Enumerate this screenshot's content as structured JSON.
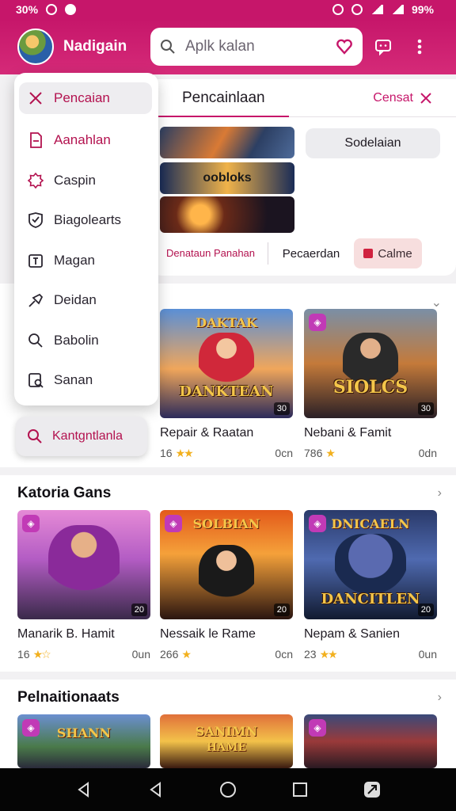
{
  "status_bar": {
    "left_text": "30%",
    "right_text": "99%"
  },
  "header": {
    "app_name": "Nadigain",
    "search_placeholder": "Aplk kalan"
  },
  "tab_strip": {
    "active_tab": "Pencainlaan",
    "cancel_label": "Censat"
  },
  "panel": {
    "banner_label": "oobloks",
    "side_button": "Sodelaian",
    "chip_1": "Denataun Panahan",
    "chip_2": "Pecaerdan",
    "chip_3": "Calme"
  },
  "menu": {
    "items": [
      {
        "label": "Pencaian",
        "icon": "close-icon"
      },
      {
        "label": "Aanahlan",
        "icon": "document-icon"
      },
      {
        "label": "Caspin",
        "icon": "badge-icon"
      },
      {
        "label": "Biagolearts",
        "icon": "shield-icon"
      },
      {
        "label": "Magan",
        "icon": "text-box-icon"
      },
      {
        "label": "Deidan",
        "icon": "arrow-icon"
      },
      {
        "label": "Babolin",
        "icon": "search-icon"
      },
      {
        "label": "Sanan",
        "icon": "lock-search-icon"
      }
    ],
    "bottom_search_label": "Kantgntlanla"
  },
  "sections": [
    {
      "title": "",
      "cards": [
        {
          "title": "Repair & Raatan",
          "rating": "16",
          "size": "0cn",
          "logo_top": "DAKTAK",
          "logo": "DANKTEAN",
          "badge": "30"
        },
        {
          "title": "Nebani & Famit",
          "rating": "786",
          "size": "0dn",
          "logo_top": "",
          "logo": "SIOLCS",
          "badge": "30"
        }
      ]
    },
    {
      "title": "Katoria Gans",
      "cards": [
        {
          "title": "Manarik B. Hamit",
          "rating": "16",
          "size": "0un",
          "logo_top": "",
          "logo": "",
          "badge": "20"
        },
        {
          "title": "Nessaik le Rame",
          "rating": "266",
          "size": "0cn",
          "logo_top": "SOLBIAN",
          "logo": "",
          "badge": "20"
        },
        {
          "title": "Nepam & Sanien",
          "rating": "23",
          "size": "0un",
          "logo_top": "DNICAELN",
          "logo": "DANCITLEN",
          "badge": "20"
        }
      ]
    },
    {
      "title": "Pelnaitionaats",
      "cards": [
        {
          "title": "",
          "logo_top": "SHANN",
          "logo": ""
        },
        {
          "title": "",
          "logo_top": "SANIMN",
          "logo": "HAME"
        },
        {
          "title": "",
          "logo_top": "",
          "logo": ""
        }
      ]
    }
  ],
  "colors": {
    "brand": "#c6166a",
    "accent_text": "#b3124f",
    "star": "#f2b01e"
  }
}
